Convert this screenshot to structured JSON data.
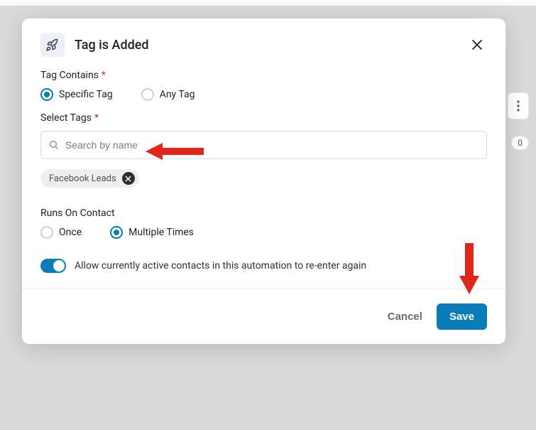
{
  "modal": {
    "title": "Tag is Added",
    "tag_contains": {
      "label": "Tag Contains",
      "options": {
        "specific": "Specific Tag",
        "any": "Any Tag"
      }
    },
    "select_tags": {
      "label": "Select Tags",
      "placeholder": "Search by name",
      "chip": "Facebook Leads"
    },
    "runs_on": {
      "label": "Runs On Contact",
      "options": {
        "once": "Once",
        "multiple": "Multiple Times"
      }
    },
    "toggle_label": "Allow currently active contacts in this automation to re-enter again",
    "footer": {
      "cancel": "Cancel",
      "save": "Save"
    }
  },
  "background": {
    "badge": "0"
  }
}
